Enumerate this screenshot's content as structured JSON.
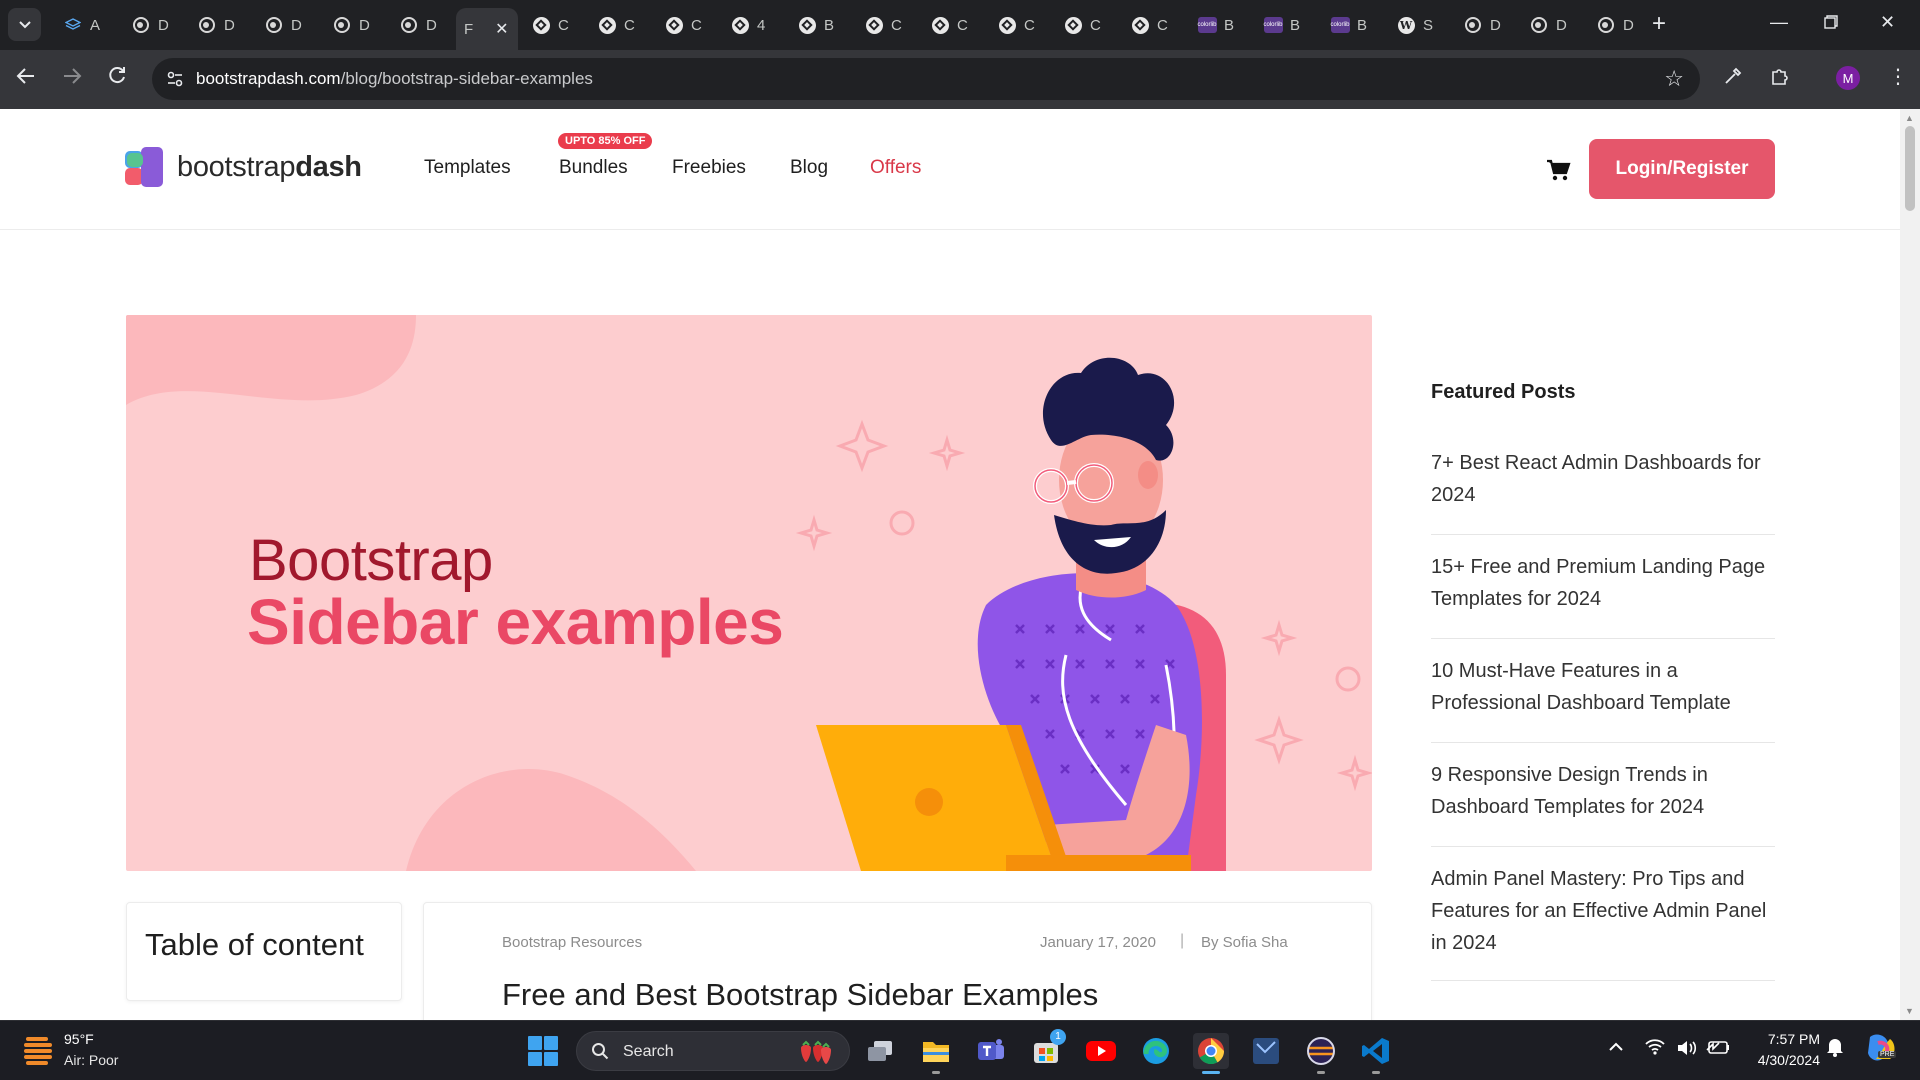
{
  "browser": {
    "tabs": [
      {
        "icon": "stack-icon",
        "label": "A"
      },
      {
        "icon": "globe-icon",
        "label": "D"
      },
      {
        "icon": "globe-icon",
        "label": "D"
      },
      {
        "icon": "globe-icon",
        "label": "D"
      },
      {
        "icon": "globe-icon",
        "label": "D"
      },
      {
        "icon": "globe-icon",
        "label": "D"
      },
      {
        "icon": "none",
        "label": "F",
        "active": true
      },
      {
        "icon": "codepen-icon",
        "label": "C"
      },
      {
        "icon": "codepen-icon",
        "label": "C"
      },
      {
        "icon": "codepen-icon",
        "label": "C"
      },
      {
        "icon": "codepen-icon",
        "label": "4"
      },
      {
        "icon": "codepen-icon",
        "label": "B"
      },
      {
        "icon": "codepen-icon",
        "label": "C"
      },
      {
        "icon": "codepen-icon",
        "label": "C"
      },
      {
        "icon": "codepen-icon",
        "label": "C"
      },
      {
        "icon": "codepen-icon",
        "label": "C"
      },
      {
        "icon": "codepen-icon",
        "label": "C"
      },
      {
        "icon": "colorlib-icon",
        "label": "B"
      },
      {
        "icon": "colorlib-icon",
        "label": "B"
      },
      {
        "icon": "colorlib-icon",
        "label": "B"
      },
      {
        "icon": "wordpress-icon",
        "label": "S"
      },
      {
        "icon": "globe-icon",
        "label": "D"
      },
      {
        "icon": "globe-icon",
        "label": "D"
      },
      {
        "icon": "globe-icon",
        "label": "D"
      }
    ],
    "colorlib_text": "colorlib",
    "profile_initial": "M",
    "url_host": "bootstrapdash.com",
    "url_path": "/blog/bootstrap-sidebar-examples"
  },
  "site": {
    "logo_light": "bootstrap",
    "logo_bold": "dash",
    "nav": {
      "templates": "Templates",
      "bundles": "Bundles",
      "bundles_badge": "UPTO 85% OFF",
      "freebies": "Freebies",
      "blog": "Blog",
      "offers": "Offers"
    },
    "login_label": "Login/Register",
    "accent_color": "#e5566b"
  },
  "hero": {
    "line1": "Bootstrap",
    "line2": "Sidebar examples"
  },
  "sidebar": {
    "title": "Featured Posts",
    "posts": [
      "7+ Best React Admin Dashboards for 2024",
      "15+ Free and Premium Landing Page Templates for 2024",
      "10 Must-Have Features in a Professional Dashboard Template",
      "9 Responsive Design Trends in Dashboard Templates for 2024",
      "Admin Panel Mastery: Pro Tips and Features for an Effective Admin Panel in 2024"
    ]
  },
  "toc": {
    "title": "Table of content"
  },
  "article": {
    "category": "Bootstrap Resources",
    "date": "January 17, 2020",
    "separator": "|",
    "author": "By  Sofia Sha",
    "title": "Free and Best Bootstrap Sidebar Examples"
  },
  "taskbar": {
    "temperature": "95°F",
    "condition": "Air: Poor",
    "search_label": "Search",
    "store_badge": "1",
    "time": "7:57 PM",
    "date": "4/30/2024",
    "copilot_badge": "PRE"
  }
}
